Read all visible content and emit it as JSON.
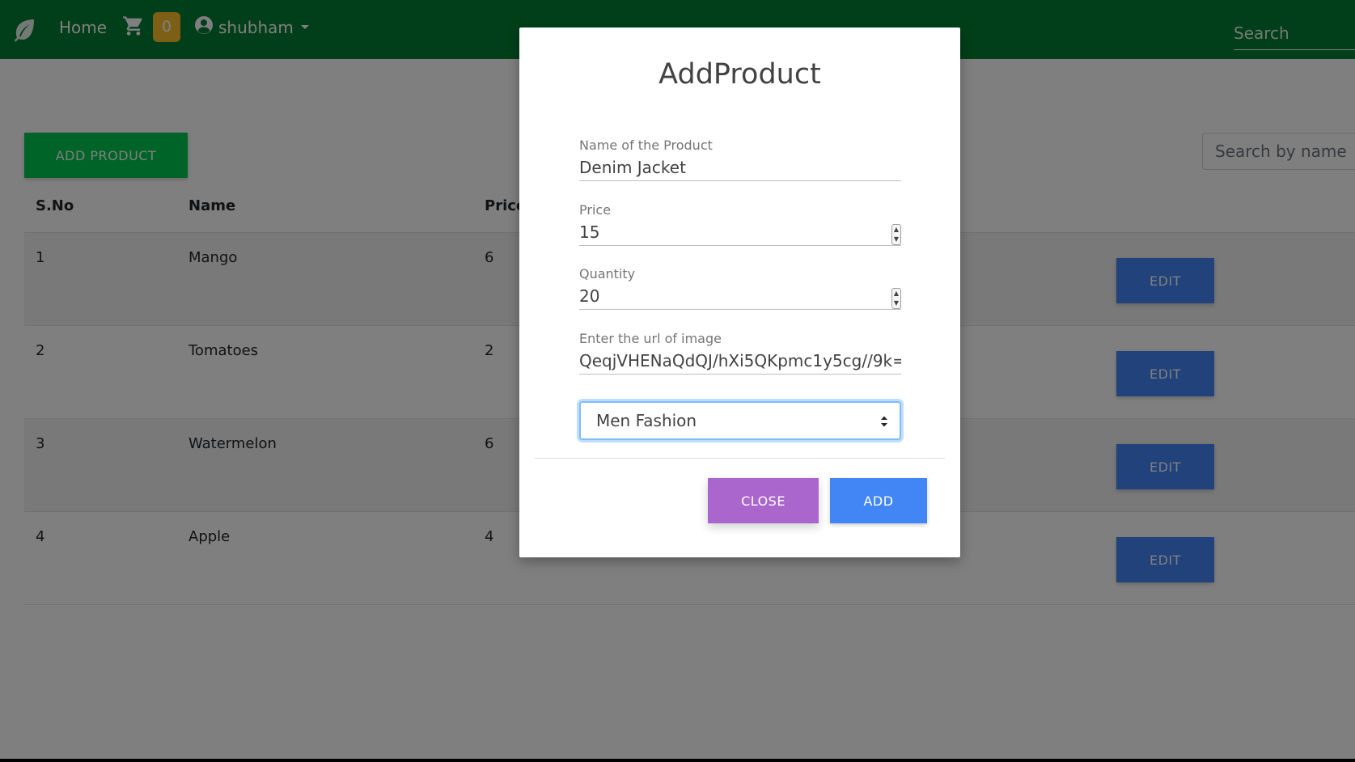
{
  "navbar": {
    "home_label": "Home",
    "cart_count": "0",
    "username": "shubham",
    "search_placeholder": "Search",
    "colors": {
      "background": "#007e33",
      "badge": "#fbc02d"
    },
    "icons": [
      "leaf-icon",
      "cart-icon",
      "user-circle-icon",
      "caret-down-icon"
    ]
  },
  "page": {
    "add_product_label": "ADD PRODUCT",
    "search_placeholder": "Search by name",
    "table": {
      "headers": {
        "sno": "S.No",
        "name": "Name",
        "price": "Price"
      },
      "rows": [
        {
          "sno": "1",
          "name": "Mango",
          "price": "6",
          "edit_label": "EDIT"
        },
        {
          "sno": "2",
          "name": "Tomatoes",
          "price": "2",
          "edit_label": "EDIT"
        },
        {
          "sno": "3",
          "name": "Watermelon",
          "price": "6",
          "edit_label": "EDIT"
        },
        {
          "sno": "4",
          "name": "Apple",
          "price": "4",
          "edit_label": "EDIT"
        }
      ]
    }
  },
  "modal": {
    "title": "AddProduct",
    "fields": {
      "name": {
        "label": "Name of the Product",
        "value": "Denim Jacket"
      },
      "price": {
        "label": "Price",
        "value": "15"
      },
      "quantity": {
        "label": "Quantity",
        "value": "20"
      },
      "image_url": {
        "label": "Enter the url of image",
        "value": "QeqjVHENaQdQJ/hXi5QKpmc1y5cg//9k="
      }
    },
    "category": {
      "selected": "Men Fashion"
    },
    "close_label": "CLOSE",
    "add_label": "ADD",
    "colors": {
      "close": "#aa66cc",
      "add": "#4285f4"
    }
  }
}
